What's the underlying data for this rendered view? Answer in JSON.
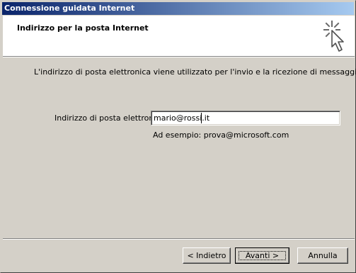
{
  "window": {
    "title": "Connessione guidata Internet"
  },
  "header": {
    "title": "Indirizzo per la posta Internet",
    "icon": "wizard-cursor-sparkle-icon"
  },
  "content": {
    "intro": "L'indirizzo di posta elettronica viene utilizzato per l'invio e la ricezione di messaggi.",
    "email_label": "Indirizzo di posta elettronica:",
    "email_value": "mario@rossi.it",
    "example": "Ad esempio: prova@microsoft.com"
  },
  "buttons": {
    "back": "< Indietro",
    "next": "Avanti >",
    "cancel": "Annulla"
  },
  "colors": {
    "title_gradient_start": "#0a246a",
    "title_gradient_end": "#a6caf0",
    "face": "#d4d0c8"
  }
}
